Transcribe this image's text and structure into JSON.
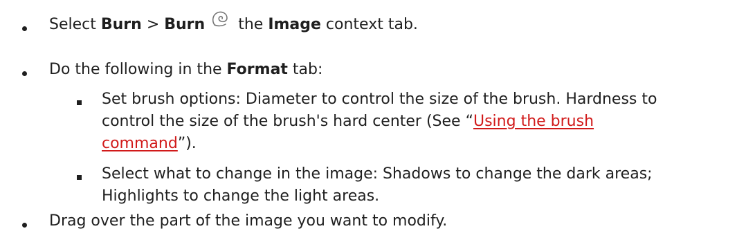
{
  "bullets": [
    {
      "select": "Select ",
      "burn1": "Burn",
      "gt": " > ",
      "burn2": "Burn",
      "the": "the ",
      "image": "Image",
      "tail": " context tab."
    },
    {
      "lead": "Do the following in the ",
      "format": "Format",
      "tail": " tab:"
    },
    {
      "line1": "Set brush options: Diameter to control the size of the brush. Hardness to",
      "line2_pre": "control the size of the brush's hard center (See “",
      "link_part1": "Using the brush",
      "link_part2": "command",
      "line3_post": "”)."
    },
    {
      "line1": "Select what to change in the image: Shadows to change the dark areas;",
      "line2": "Highlights to change the light areas."
    },
    {
      "text": "Drag over the part of the image you want to modify."
    }
  ],
  "icons": {
    "burn": "burn-icon"
  }
}
